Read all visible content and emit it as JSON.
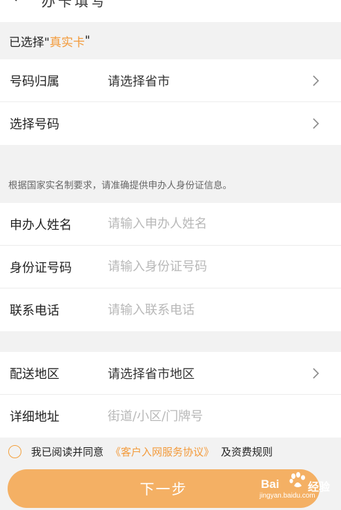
{
  "header": {
    "title": "办卡填写"
  },
  "selected": {
    "prefix": "已选择\"",
    "card": "真实卡",
    "suffix": "\""
  },
  "number_group": {
    "region_label": "号码归属",
    "region_value": "请选择省市",
    "number_label": "选择号码"
  },
  "notice": "根据国家实名制要求，请准确提供申办人身份证信息。",
  "identity_group": {
    "name_label": "申办人姓名",
    "name_placeholder": "请输入申办人姓名",
    "id_label": "身份证号码",
    "id_placeholder": "请输入身份证号码",
    "phone_label": "联系电话",
    "phone_placeholder": "请输入联系电话"
  },
  "address_group": {
    "area_label": "配送地区",
    "area_value": "请选择省市地区",
    "detail_label": "详细地址",
    "detail_placeholder": "街道/小区/门牌号"
  },
  "agreement": {
    "prefix": "我已阅读并同意",
    "link": "《客户入网服务协议》",
    "suffix": "及资费规则"
  },
  "next_button": "下一步",
  "watermark": {
    "brand": "Bai",
    "cn": "经验",
    "url": "jingyan.baidu.com"
  },
  "colors": {
    "accent": "#f39a3a",
    "button": "#f4b064",
    "page_bg": "#f2f2f2"
  }
}
